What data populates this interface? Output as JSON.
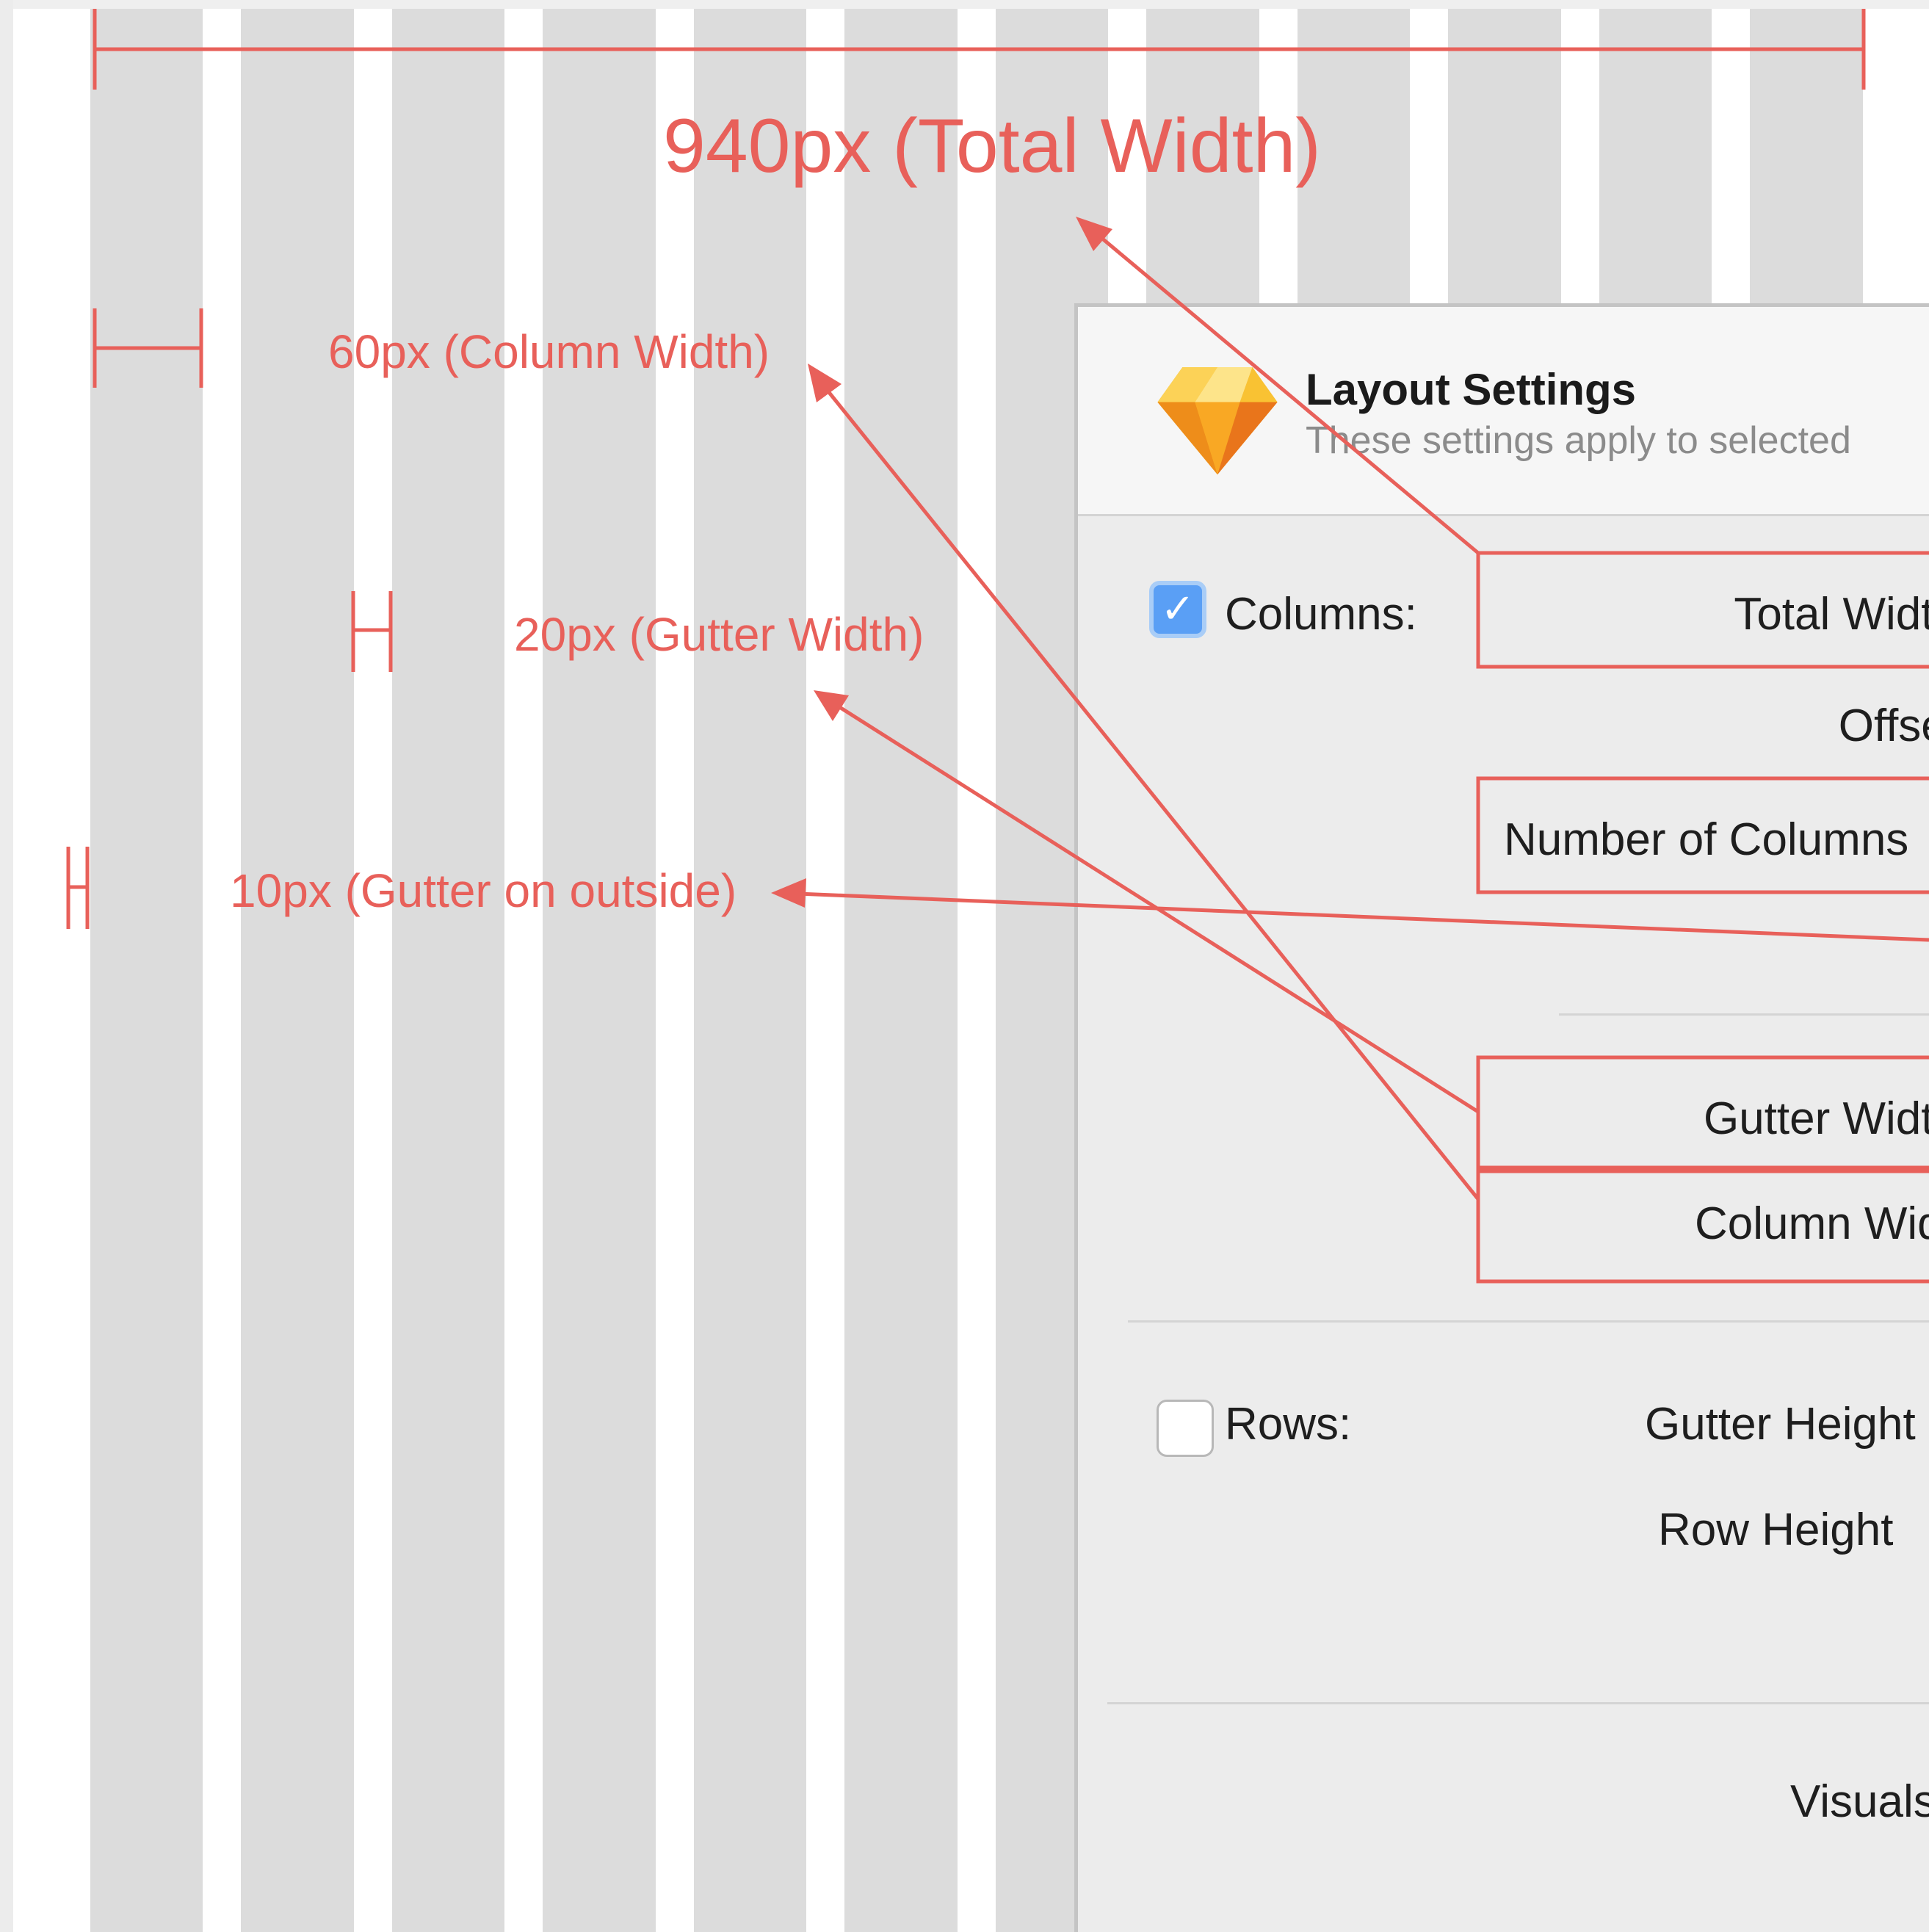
{
  "annotations": {
    "total_width": "940px (Total Width)",
    "column_width": "60px (Column Width)",
    "gutter_width": "20px (Gutter Width)",
    "gutter_outside": "10px (Gutter on outside)"
  },
  "dialog": {
    "title": "Layout Settings",
    "subtitle": "These settings apply to selected",
    "columns": {
      "checkbox_checked": true,
      "label": "Columns:",
      "total_width_label": "Total Width",
      "offset_label": "Offset",
      "number_of_columns_label": "Number of Columns",
      "gutter_width_label": "Gutter Width",
      "column_width_label": "Column Width"
    },
    "rows": {
      "checkbox_checked": false,
      "label": "Rows:",
      "gutter_height_label": "Gutter Height",
      "row_height_label": "Row Height"
    },
    "visuals_label": "Visuals"
  },
  "colors": {
    "annotation": "#e8605a",
    "column_fill": "#dcdcdc",
    "checkbox_accent": "#5a9ff5"
  },
  "icons": [
    "sketch-diamond-icon",
    "checkmark-icon"
  ]
}
